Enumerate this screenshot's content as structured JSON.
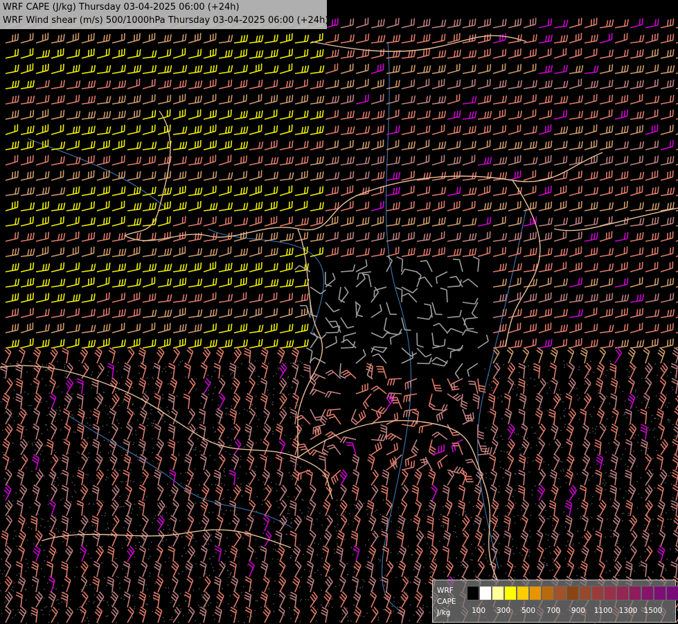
{
  "title": {
    "line1": "WRF CAPE (J/kg) Thursday 03-04-2025 06:00 (+24h)",
    "line2": "WRF Wind shear (m/s) 500/1000hPa Thursday 03-04-2025 06:00 (+24h)"
  },
  "legend": {
    "line1": "WRF",
    "line2": "CAPE",
    "line3": "J/kg",
    "colors": [
      "#000000",
      "#ffffff",
      "#ffff99",
      "#ffff00",
      "#ffcc00",
      "#e69500",
      "#b86a10",
      "#a0522d",
      "#8b4513",
      "#944a2e",
      "#9a3b3b",
      "#9a2f47",
      "#952552",
      "#8e1c5d",
      "#86146a",
      "#7e0e74",
      "#7a0a7a"
    ],
    "ticks": [
      "100",
      "300",
      "500",
      "700",
      "900",
      "1100",
      "1300",
      "1500"
    ]
  },
  "barb_colors": {
    "yellow": "#f0f000",
    "salmon": "#e07b6a",
    "tan": "#d09a6a",
    "magenta": "#d000d0",
    "pink": "#c08080",
    "grey": "#a0a0a0",
    "border": "#e8c09a",
    "river": "#3a6ea5"
  }
}
